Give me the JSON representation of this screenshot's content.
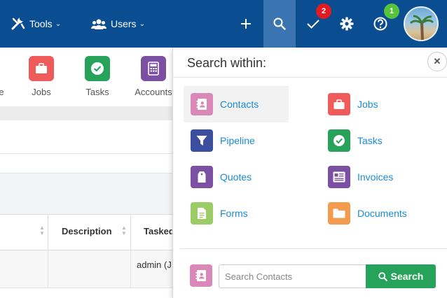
{
  "header": {
    "tools_label": "Tools",
    "users_label": "Users",
    "tasks_badge": "2",
    "profile_badge": "1"
  },
  "quick_tiles": [
    {
      "label": "e",
      "color": "#fff",
      "icon": "partial"
    },
    {
      "label": "Jobs",
      "color": "#ef5b5b",
      "icon": "briefcase-icon"
    },
    {
      "label": "Tasks",
      "color": "#27a25b",
      "icon": "check-circle-icon"
    },
    {
      "label": "Accounts",
      "color": "#7b4fa1",
      "icon": "calculator-icon"
    }
  ],
  "table": {
    "headers": [
      "Description",
      "Tasked"
    ],
    "row1": {
      "tasked": "admin (J"
    }
  },
  "search_panel": {
    "title": "Search within:",
    "options": [
      {
        "label": "Contacts",
        "color": "#d988b9",
        "icon": "contact-book-icon",
        "selected": true
      },
      {
        "label": "Jobs",
        "color": "#ef5b5b",
        "icon": "briefcase-icon"
      },
      {
        "label": "Pipeline",
        "color": "#3c4f9e",
        "icon": "funnel-icon"
      },
      {
        "label": "Tasks",
        "color": "#27a25b",
        "icon": "check-circle-icon"
      },
      {
        "label": "Quotes",
        "color": "#7b4fa1",
        "icon": "tag-icon"
      },
      {
        "label": "Invoices",
        "color": "#7b4fa1",
        "icon": "invoice-icon"
      },
      {
        "label": "Forms",
        "color": "#9ccc65",
        "icon": "document-icon"
      },
      {
        "label": "Documents",
        "color": "#f39c4f",
        "icon": "folder-icon"
      }
    ],
    "search_placeholder": "Search Contacts",
    "search_button": "Search",
    "close_symbol": "✕"
  }
}
